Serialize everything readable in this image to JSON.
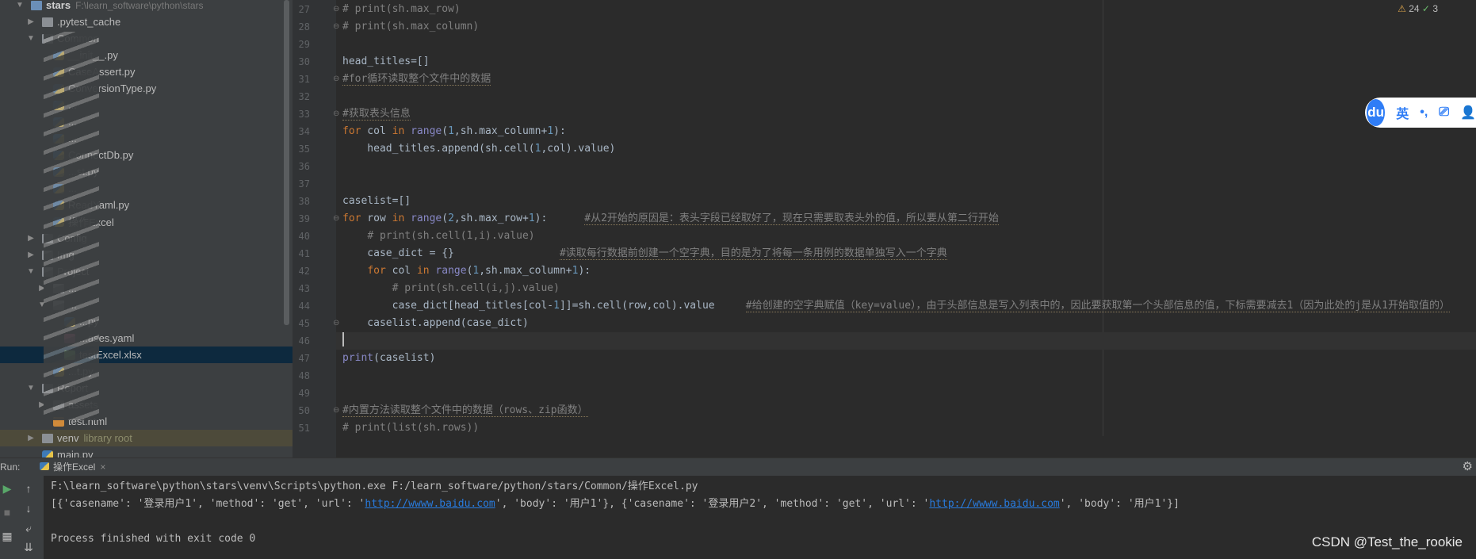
{
  "tree": {
    "items": [
      {
        "arrow": "▼",
        "icon": "folder-b",
        "label": "stars",
        "bold": true,
        "path": "F:\\learn_software\\python\\stars"
      },
      {
        "arrow": "▶",
        "icon": "folder",
        "label": ".pytest_cache"
      },
      {
        "arrow": "▼",
        "icon": "folder",
        "label": "Common"
      },
      {
        "arrow": "",
        "icon": "py",
        "label": "__init__.py"
      },
      {
        "arrow": "",
        "icon": "py",
        "label": "CaseAssert.py"
      },
      {
        "arrow": "",
        "icon": "py",
        "label": "ConversionType.py"
      },
      {
        "arrow": "",
        "icon": "py",
        "label": "..."
      },
      {
        "arrow": "",
        "icon": "py",
        "label": "..."
      },
      {
        "arrow": "",
        "icon": "py",
        "label": "..."
      },
      {
        "arrow": "",
        "icon": "py",
        "label": "ConnectDb.py"
      },
      {
        "arrow": "",
        "icon": "py",
        "label": "...st.py"
      },
      {
        "arrow": "",
        "icon": "py",
        "label": "..."
      },
      {
        "arrow": "",
        "icon": "py",
        "label": "ReadYaml.py"
      },
      {
        "arrow": "",
        "icon": "py",
        "label": "操作Excel"
      },
      {
        "arrow": "▶",
        "icon": "folder",
        "label": "Config"
      },
      {
        "arrow": "▶",
        "icon": "folder",
        "label": "Img"
      },
      {
        "arrow": "▼",
        "icon": "folder",
        "label": "Project"
      },
      {
        "arrow": "▶",
        "icon": "folder",
        "label": "..."
      },
      {
        "arrow": "▼",
        "icon": "folder",
        "label": "..."
      },
      {
        "arrow": "",
        "icon": "py",
        "label": "...py"
      },
      {
        "arrow": "",
        "icon": "yaml",
        "label": "...ases.yaml"
      },
      {
        "arrow": "",
        "icon": "xlsx",
        "label": "testExcel.xlsx",
        "selected": true
      },
      {
        "arrow": "",
        "icon": "py",
        "label": "...t.py"
      },
      {
        "arrow": "▼",
        "icon": "folder",
        "label": "Report"
      },
      {
        "arrow": "▶",
        "icon": "folder",
        "label": "assets"
      },
      {
        "arrow": "",
        "icon": "html",
        "label": "test.html"
      },
      {
        "arrow": "▶",
        "icon": "folder",
        "label": "venv",
        "lib": "library root",
        "venv": true
      },
      {
        "arrow": "",
        "icon": "py",
        "label": "main.py"
      },
      {
        "arrow": "",
        "icon": "py",
        "label": "test_run.py"
      }
    ]
  },
  "editor": {
    "warnings": "24",
    "checks": "3",
    "lines": [
      {
        "n": "27",
        "html": "<span class=\"cm\"># print(sh.max_row)</span>",
        "fold": true
      },
      {
        "n": "28",
        "html": "<span class=\"cm\"># print(sh.max_column)</span>",
        "fold": true
      },
      {
        "n": "29",
        "html": ""
      },
      {
        "n": "30",
        "html": "head_titles=[]"
      },
      {
        "n": "31",
        "html": "<span class=\"cm uline\">#for循环读取整个文件中的数据</span>",
        "fold": true
      },
      {
        "n": "32",
        "html": ""
      },
      {
        "n": "33",
        "html": "<span class=\"cm uline\">#获取表头信息</span>",
        "fold": true
      },
      {
        "n": "34",
        "html": "<span class=\"kw\">for</span> col <span class=\"kw\">in</span> <span class=\"bi\">range</span>(<span class=\"num\">1</span>,sh.max_column+<span class=\"num\">1</span>):"
      },
      {
        "n": "35",
        "html": "    head_titles.append(sh.cell(<span class=\"num\">1</span>,col).value)"
      },
      {
        "n": "36",
        "html": ""
      },
      {
        "n": "37",
        "html": ""
      },
      {
        "n": "38",
        "html": "caselist=[]"
      },
      {
        "n": "39",
        "html": "<span class=\"kw\">for</span> row <span class=\"kw\">in</span> <span class=\"bi\">range</span>(<span class=\"num\">2</span>,sh.max_row+<span class=\"num\">1</span>):      <span class=\"cm uline\">#从2开始的原因是：表头字段已经取好了，现在只需要取表头外的值，所以要从第二行开始</span>",
        "fold": true
      },
      {
        "n": "40",
        "html": "    <span class=\"cm\"># print(sh.cell(1,i).value)</span>"
      },
      {
        "n": "41",
        "html": "    case_dict = {}                 <span class=\"cm uline\">#读取每行数据前创建一个空字典，目的是为了将每一条用例的数据单独写入一个字典</span>"
      },
      {
        "n": "42",
        "html": "    <span class=\"kw\">for</span> col <span class=\"kw\">in</span> <span class=\"bi\">range</span>(<span class=\"num\">1</span>,sh.max_column+<span class=\"num\">1</span>):"
      },
      {
        "n": "43",
        "html": "        <span class=\"cm\"># print(sh.cell(i,j).value)</span>"
      },
      {
        "n": "44",
        "html": "        case_dict[head_titles[col-<span class=\"num\">1</span>]]=sh.cell(row,col).value     <span class=\"cm uline\">#给创建的空字典赋值（key=value），由于头部信息是写入列表中的，因此要获取第一个头部信息的值，下标需要减去1（因为此处的j是从1开始取值的）</span>"
      },
      {
        "n": "45",
        "html": "    caselist.append(case_dict)",
        "fold": true
      },
      {
        "n": "46",
        "html": "",
        "current": true
      },
      {
        "n": "47",
        "html": "<span class=\"bi\">print</span>(caselist)"
      },
      {
        "n": "48",
        "html": ""
      },
      {
        "n": "49",
        "html": ""
      },
      {
        "n": "50",
        "html": "<span class=\"cm uline\">#内置方法读取整个文件中的数据（rows、zip函数）</span>",
        "fold": true
      },
      {
        "n": "51",
        "html": "<span class=\"cm\"># print(list(sh.rows))</span>"
      }
    ]
  },
  "ime": {
    "logo": "du",
    "items": [
      "英",
      "•,",
      "⎚",
      "👤"
    ]
  },
  "run": {
    "label": "Run:",
    "tab": "操作Excel",
    "close": "×",
    "line1": "F:\\learn_software\\python\\stars\\venv\\Scripts\\python.exe F:/learn_software/python/stars/Common/操作Excel.py",
    "line2_parts": [
      "[{'casename': '登录用户1', 'method': 'get', 'url': '",
      "http://wwww.baidu.com",
      "', 'body': '用户1'}, {'casename': '登录用户2', 'method': 'get', 'url': '",
      "http://wwww.baidu.com",
      "', 'body': '用户1'}]"
    ],
    "line4": "Process finished with exit code 0"
  },
  "watermark": "CSDN @Test_the_rookie",
  "colors": {
    "accent": "#4a88c7",
    "link": "#287bde",
    "selection": "#0d293e"
  }
}
